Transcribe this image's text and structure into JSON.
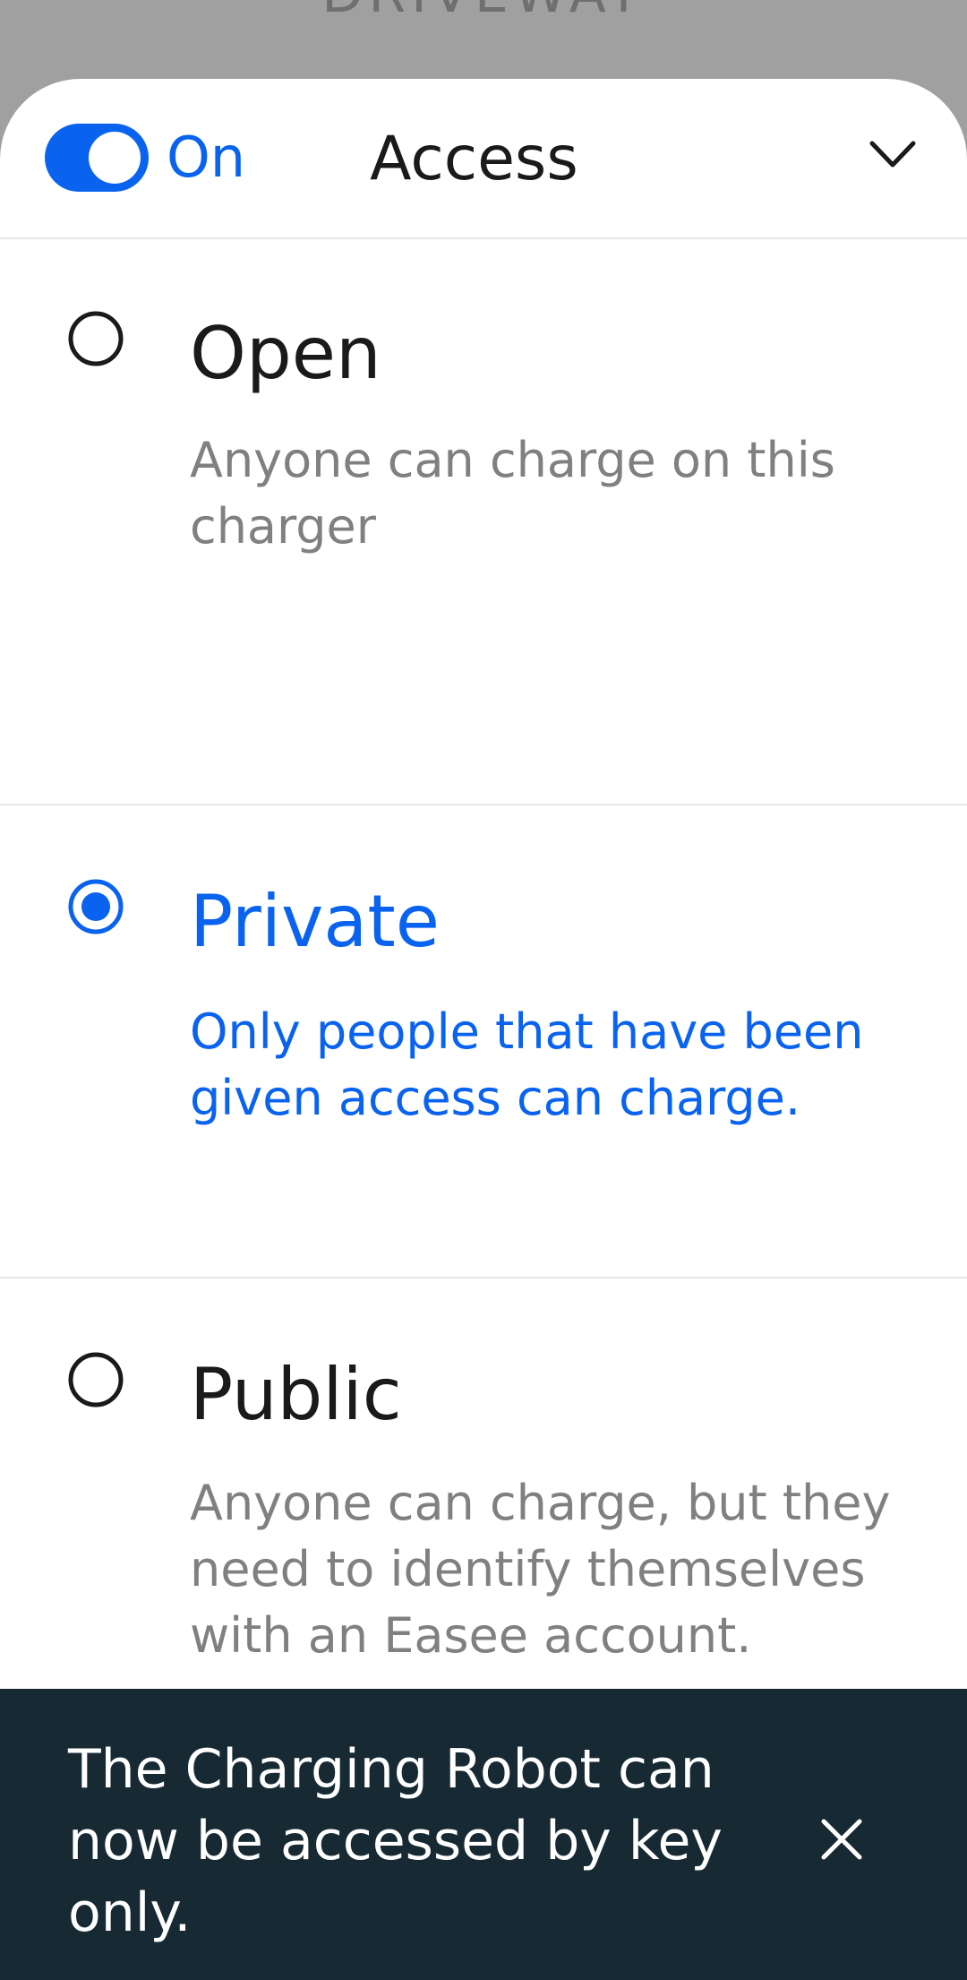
{
  "backdrop": {
    "title": "DRIVEWAY"
  },
  "sheet": {
    "toggle": {
      "state": "on",
      "label": "On"
    },
    "title": "Access",
    "options": [
      {
        "title": "Open",
        "description": "Anyone can charge on this charger",
        "selected": false
      },
      {
        "title": "Private",
        "description": "Only people that have been given access can charge.",
        "selected": true
      },
      {
        "title": "Public",
        "description": "Anyone can charge, but they need to identify themselves with an Easee account.",
        "selected": false
      }
    ]
  },
  "snackbar": {
    "message": "The Charging Robot can now be accessed by key only."
  },
  "colors": {
    "accent": "#0a63ef",
    "snackbar_bg": "#172a33",
    "backdrop": "#a0a0a0",
    "muted_text": "#808080"
  },
  "icons": [
    "chevron-down-icon",
    "radio-unchecked-icon",
    "radio-checked-icon",
    "close-icon"
  ]
}
